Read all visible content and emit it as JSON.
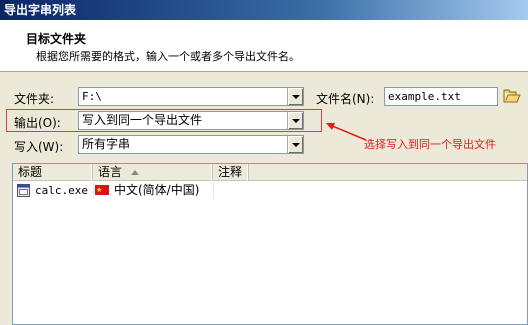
{
  "window": {
    "title": "导出字串列表"
  },
  "header": {
    "title": "目标文件夹",
    "subtitle": "根据您所需要的格式，输入一个或者多个导出文件名。"
  },
  "form": {
    "folder_label": "文件夹:",
    "folder_value": "F:\\",
    "filename_label": "文件名(N):",
    "filename_value": "example.txt",
    "output_label": "输出(O):",
    "output_value": "写入到同一个导出文件",
    "write_label": "写入(W):",
    "write_value": "所有字串"
  },
  "annotation": {
    "text": "选择写入到同一个导出文件",
    "color": "#e01c1c"
  },
  "list": {
    "columns": [
      "标题",
      "语言",
      "注释"
    ],
    "rows": [
      {
        "title": "calc.exe",
        "language": "中文(简体/中国)",
        "note": ""
      }
    ]
  },
  "colors": {
    "titlebar": "#0a246a",
    "highlight": "#e03a3a",
    "window_bg": "#ece9d8"
  }
}
